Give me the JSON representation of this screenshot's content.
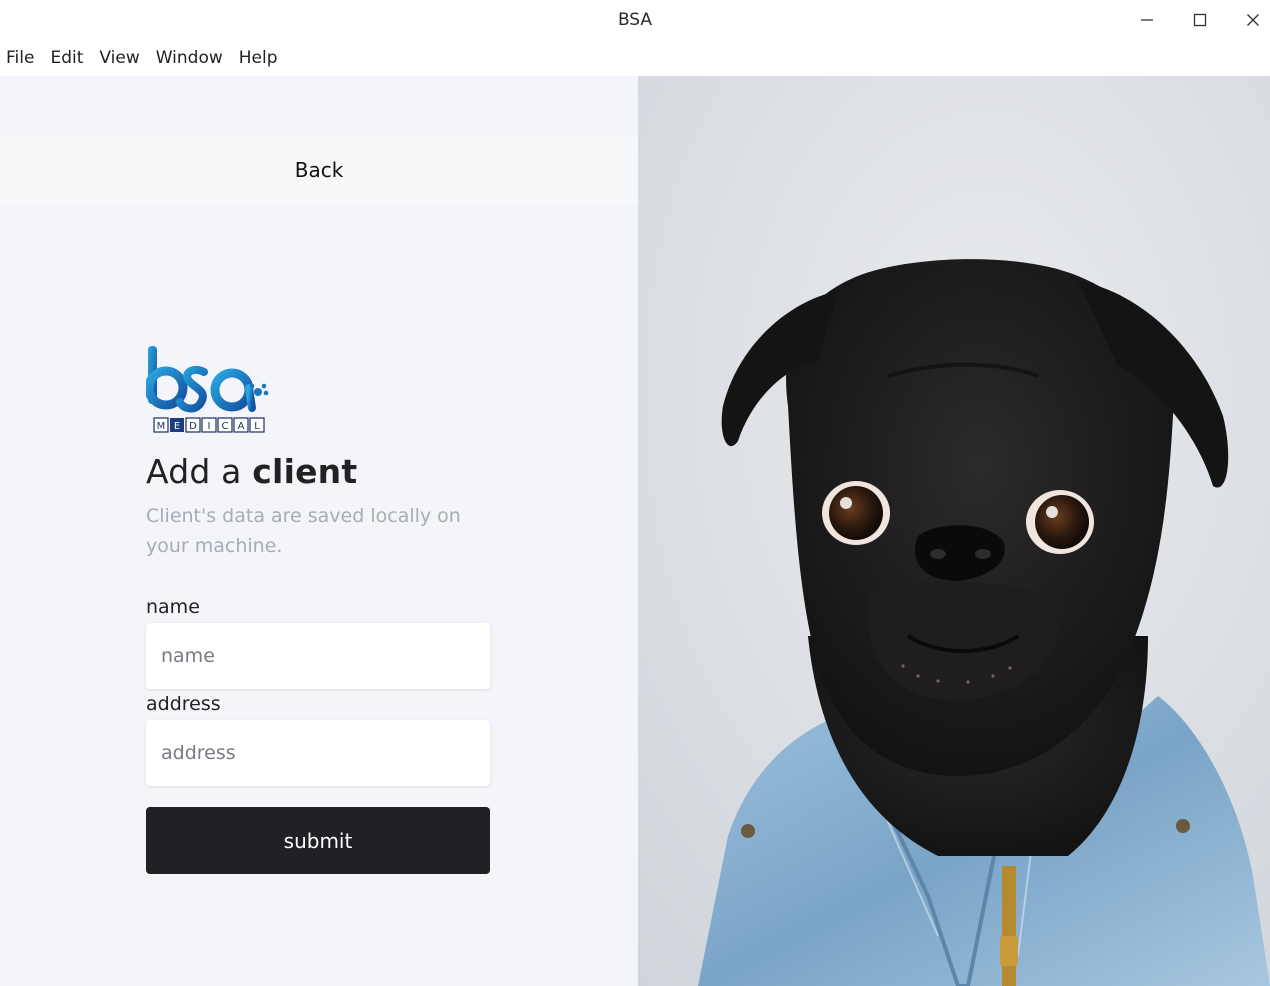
{
  "window": {
    "title": "BSA",
    "controls": [
      "minimize",
      "maximize",
      "close"
    ]
  },
  "menu": [
    "File",
    "Edit",
    "View",
    "Window",
    "Help"
  ],
  "nav": {
    "back_label": "Back"
  },
  "logo": {
    "top_text": "bsa",
    "bottom_text": "MEDICAL"
  },
  "form": {
    "title_prefix": "Add a ",
    "title_bold": "client",
    "subtitle": "Client's data are saved locally on your machine.",
    "name_label": "name",
    "name_placeholder": "name",
    "name_value": "",
    "address_label": "address",
    "address_placeholder": "address",
    "address_value": "",
    "submit_label": "submit"
  },
  "photo": {
    "subject": "black pug wearing denim jacket"
  },
  "colors": {
    "accent_dark": "#1f2126",
    "pane_bg": "#f4f5fa",
    "subtitle": "#a9acb3",
    "logo_blue": "#1b75bb"
  }
}
